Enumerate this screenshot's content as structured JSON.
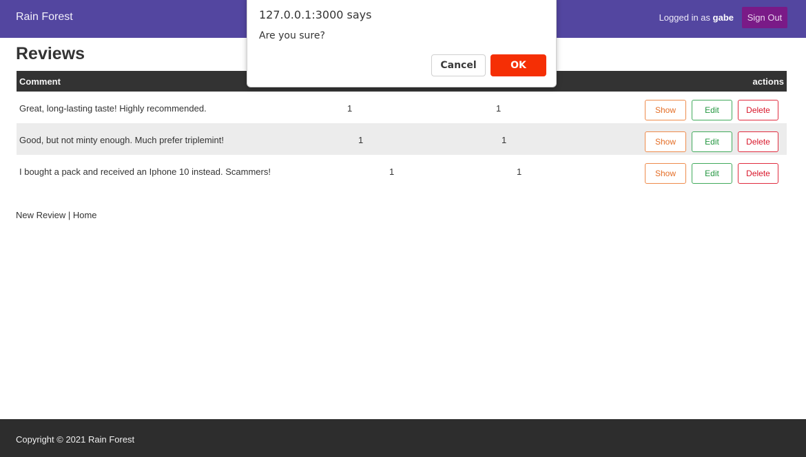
{
  "navbar": {
    "brand": "Rain Forest",
    "logged_in_prefix": "Logged in as ",
    "username": "gabe",
    "sign_out_label": "Sign Out"
  },
  "page": {
    "title": "Reviews"
  },
  "table": {
    "headers": {
      "comment": "Comment",
      "actions": "actions"
    },
    "rows": [
      {
        "comment": "Great, long-lasting taste! Highly recommended.",
        "col2": "1",
        "col3": "1",
        "show": "Show",
        "edit": "Edit",
        "delete": "Delete"
      },
      {
        "comment": "Good, but not minty enough. Much prefer triplemint!",
        "col2": "1",
        "col3": "1",
        "show": "Show",
        "edit": "Edit",
        "delete": "Delete"
      },
      {
        "comment": "I bought a pack and received an Iphone 10 instead. Scammers!",
        "col2": "1",
        "col3": "1",
        "show": "Show",
        "edit": "Edit",
        "delete": "Delete"
      }
    ]
  },
  "links": {
    "new_review": "New Review",
    "separator": " | ",
    "home": "Home"
  },
  "footer": {
    "copyright": "Copyright © 2021 Rain Forest"
  },
  "dialog": {
    "title": "127.0.0.1:3000 says",
    "message": "Are you sure?",
    "cancel_label": "Cancel",
    "ok_label": "OK",
    "ok_color": "#f52f05"
  },
  "colors": {
    "navbar": "#5346a0",
    "sign_out": "#7a1a87",
    "table_header": "#333333",
    "footer": "#2d2d2d"
  }
}
